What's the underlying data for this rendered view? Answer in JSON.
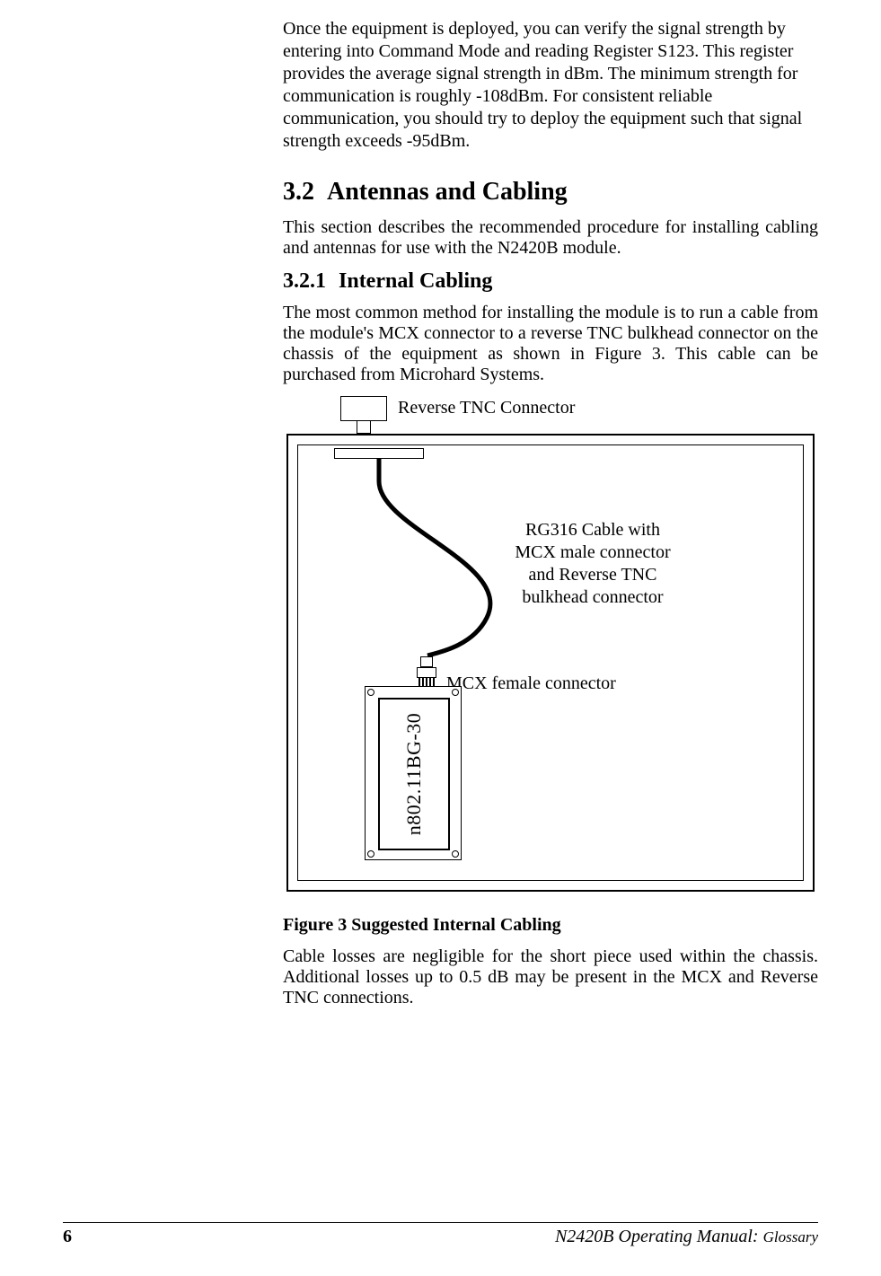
{
  "intro_para": "Once the equipment is deployed, you can verify the signal strength by entering into Command Mode and reading Register S123.  This register provides the average signal strength in dBm.  The minimum strength for communication is roughly -108dBm.  For consistent reliable communication, you should try to deploy the equipment such that signal strength exceeds -95dBm.",
  "section": {
    "number": "3.2",
    "title": "Antennas and Cabling",
    "para": "This section describes the recommended procedure for installing cabling and antennas for use with the N2420B module."
  },
  "subsection": {
    "number": "3.2.1",
    "title": "Internal Cabling",
    "para": "The most common method for installing the module is to run a cable from the module's MCX connector to a reverse TNC bulkhead connector on the chassis of the equipment as shown in Figure 3.  This cable can be purchased from Microhard Systems."
  },
  "figure": {
    "tnc_label": "Reverse TNC Connector",
    "cable_label": "RG316 Cable with MCX male connector and Reverse TNC bulkhead connector",
    "mcx_label": "MCX female connector",
    "module_label": "n802.11BG-30",
    "caption": "Figure 3 Suggested Internal Cabling"
  },
  "after_para": "Cable losses are negligible for the short piece used within the chassis.  Additional losses up to 0.5 dB may be present in the MCX and Reverse TNC connections.",
  "footer": {
    "page": "6",
    "title_main": "N2420B Operating Manual: ",
    "title_sub": "Glossary"
  }
}
